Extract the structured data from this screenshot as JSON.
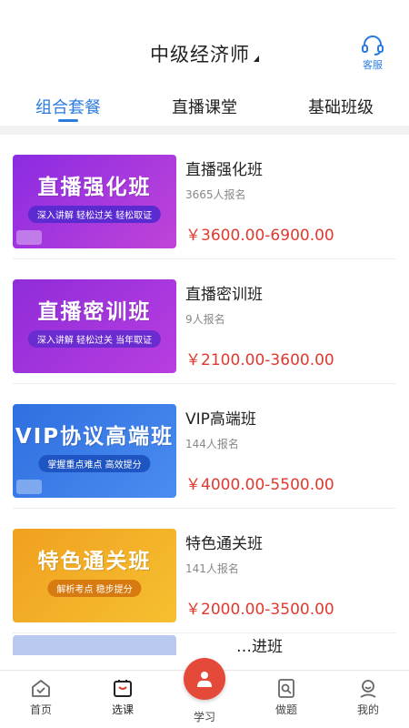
{
  "header": {
    "title": "中级经济师",
    "service_label": "客服"
  },
  "tabs": [
    {
      "label": "组合套餐"
    },
    {
      "label": "直播课堂"
    },
    {
      "label": "基础班级"
    }
  ],
  "courses": [
    {
      "name": "直播强化班",
      "count": "3665人报名",
      "price": "￥3600.00-6900.00",
      "thumb_title": "直播强化班",
      "thumb_sub": "深入讲解 轻松过关 轻松取证",
      "thumb_bg": "#8b2be2",
      "thumb_bg2": "#c044d8",
      "sub_bg": "#5b2ad1"
    },
    {
      "name": "直播密训班",
      "count": "9人报名",
      "price": "￥2100.00-3600.00",
      "thumb_title": "直播密训班",
      "thumb_sub": "深入讲解 轻松过关 当年取证",
      "thumb_bg": "#8f2cd9",
      "thumb_bg2": "#b83ee0",
      "sub_bg": "#6a2bd0"
    },
    {
      "name": "VIP高端班",
      "count": "144人报名",
      "price": "￥4000.00-5500.00",
      "thumb_title": "VIP协议高端班",
      "thumb_sub": "掌握重点难点 高效提分",
      "thumb_bg": "#2f6fe0",
      "thumb_bg2": "#4a8cf0",
      "sub_bg": "#1f55c2"
    },
    {
      "name": "特色通关班",
      "count": "141人报名",
      "price": "￥2000.00-3500.00",
      "thumb_title": "特色通关班",
      "thumb_sub": "解析考点 稳步提分",
      "thumb_bg": "#f0a020",
      "thumb_bg2": "#f6c030",
      "sub_bg": "#d77a10"
    }
  ],
  "partial": {
    "name": "…进班"
  },
  "tabbar": [
    {
      "label": "首页",
      "icon": "home-icon"
    },
    {
      "label": "选课",
      "icon": "select-course-icon"
    },
    {
      "label": "学习",
      "icon": "study-icon"
    },
    {
      "label": "做题",
      "icon": "practice-icon"
    },
    {
      "label": "我的",
      "icon": "profile-icon"
    }
  ],
  "colors": {
    "accent": "#2a7be0",
    "price": "#e03a2f",
    "center_button": "#e5493a"
  }
}
